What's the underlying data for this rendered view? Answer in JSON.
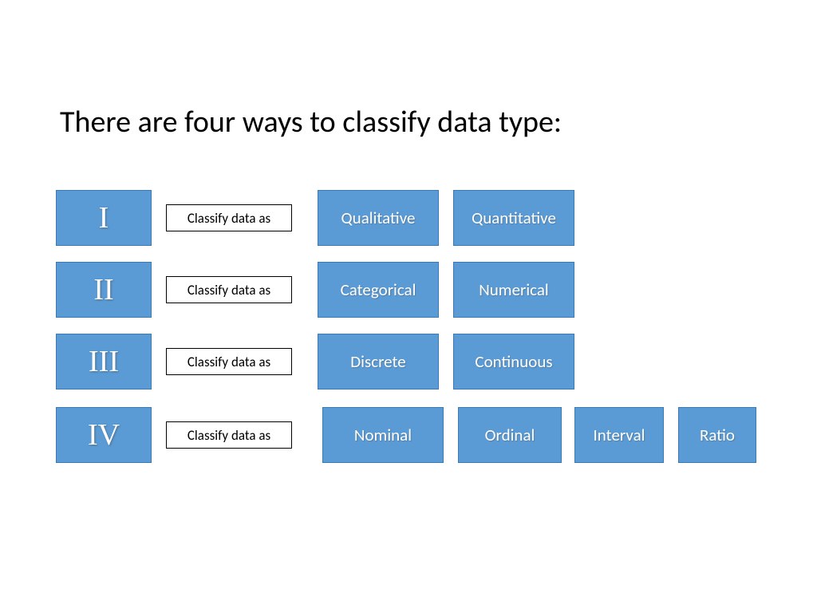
{
  "title": "There are four ways to classify data type:",
  "rows": [
    {
      "roman": "I",
      "label": "Classify data as",
      "categories": [
        "Qualitative",
        "Quantitative"
      ]
    },
    {
      "roman": "II",
      "label": "Classify data as",
      "categories": [
        "Categorical",
        "Numerical"
      ]
    },
    {
      "roman": "III",
      "label": "Classify data as",
      "categories": [
        "Discrete",
        "Continuous"
      ]
    },
    {
      "roman": "IV",
      "label": "Classify data as",
      "categories": [
        "Nominal",
        "Ordinal",
        "Interval",
        "Ratio"
      ]
    }
  ]
}
